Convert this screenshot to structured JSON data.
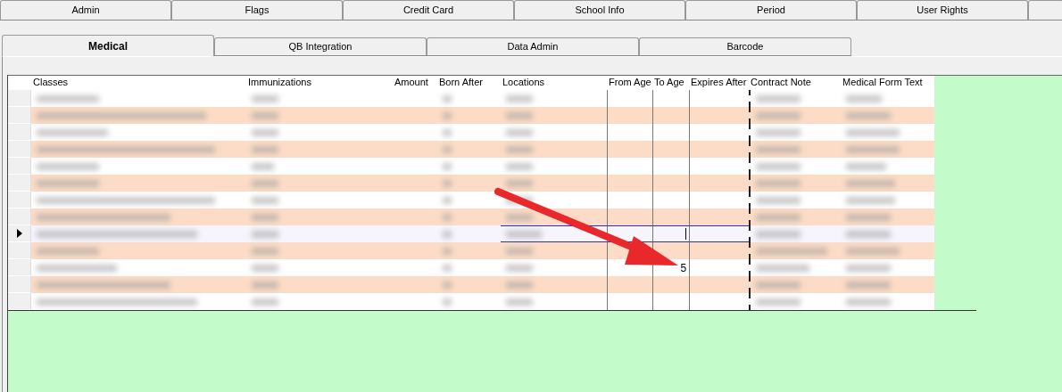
{
  "top_tabs": [
    {
      "label": "Admin",
      "selected": false
    },
    {
      "label": "Flags",
      "selected": false
    },
    {
      "label": "Credit Card",
      "selected": false
    },
    {
      "label": "School Info",
      "selected": false
    },
    {
      "label": "Period",
      "selected": false
    },
    {
      "label": "User Rights",
      "selected": false
    }
  ],
  "sub_tabs": [
    {
      "label": "Medical",
      "selected": true
    },
    {
      "label": "QB Integration",
      "selected": false
    },
    {
      "label": "Data Admin",
      "selected": false
    },
    {
      "label": "Barcode",
      "selected": false
    }
  ],
  "grid": {
    "columns": [
      "Classes",
      "Immunizations",
      "Amount",
      "Born After",
      "Locations",
      "From Age",
      "To Age",
      "Expires After",
      "Contract Note",
      "Medical Form Text"
    ],
    "rows": [
      {
        "current": false
      },
      {
        "current": false
      },
      {
        "current": false
      },
      {
        "current": false
      },
      {
        "current": false
      },
      {
        "current": false
      },
      {
        "current": false
      },
      {
        "current": false
      },
      {
        "current": true
      },
      {
        "current": false
      },
      {
        "current": false,
        "to_age": "5"
      },
      {
        "current": false
      },
      {
        "current": false
      }
    ]
  },
  "annotation": {
    "kind": "arrow"
  }
}
